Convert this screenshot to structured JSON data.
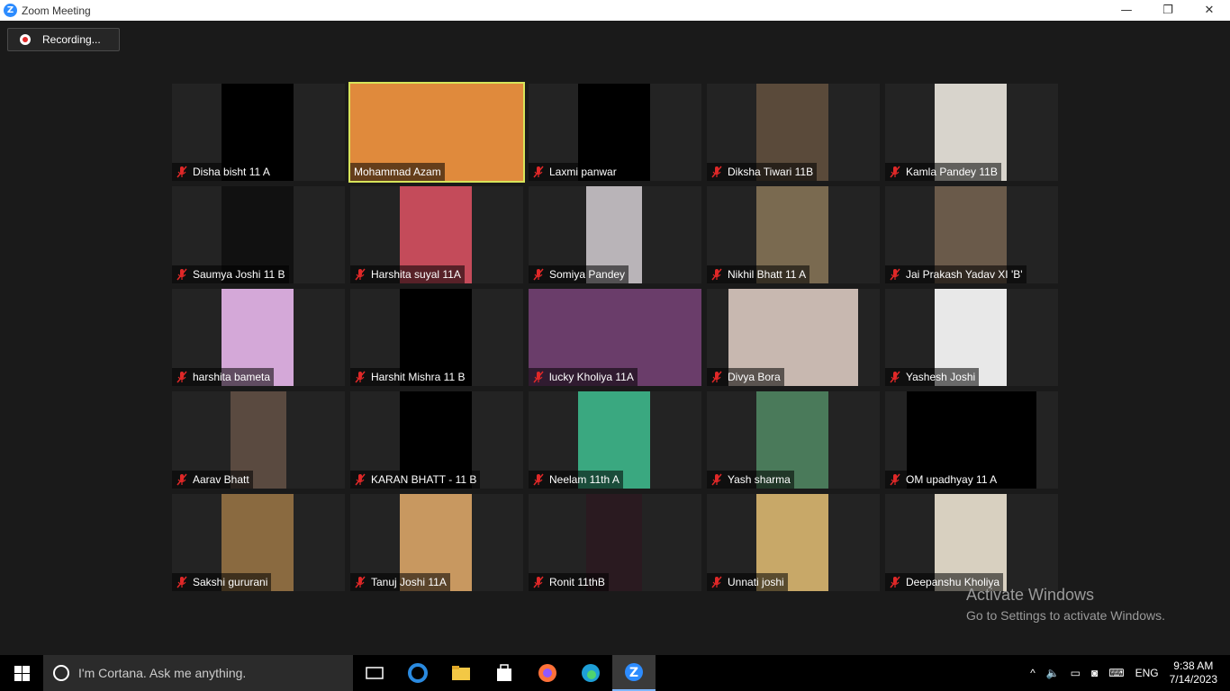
{
  "window": {
    "title": "Zoom Meeting",
    "logo_letter": "Z",
    "controls": [
      "—",
      "❐",
      "✕"
    ]
  },
  "recording": {
    "label": "Recording..."
  },
  "participants": [
    {
      "name": "Disha bisht 11 A"
    },
    {
      "name": "Mohammad Azam",
      "active_speaker": true
    },
    {
      "name": "Laxmi panwar"
    },
    {
      "name": "Diksha Tiwari 11B"
    },
    {
      "name": "Kamla Pandey 11B"
    },
    {
      "name": "Saumya Joshi 11 B"
    },
    {
      "name": "Harshita suyal 11A"
    },
    {
      "name": "Somiya Pandey"
    },
    {
      "name": "Nikhil Bhatt 11 A"
    },
    {
      "name": "Jai Prakash Yadav XI 'B'"
    },
    {
      "name": "harshita bameta"
    },
    {
      "name": "Harshit Mishra 11 B"
    },
    {
      "name": "lucky Kholiya 11A"
    },
    {
      "name": "Divya Bora"
    },
    {
      "name": "Yashesh Joshi"
    },
    {
      "name": "Aarav Bhatt"
    },
    {
      "name": "KARAN BHATT - 11 B"
    },
    {
      "name": "Neelam  11th A"
    },
    {
      "name": "Yash sharma"
    },
    {
      "name": "OM upadhyay 11 A"
    },
    {
      "name": "Sakshi gururani"
    },
    {
      "name": "Tanuj Joshi 11A"
    },
    {
      "name": "Ronit 11thB"
    },
    {
      "name": "Unnati joshi"
    },
    {
      "name": "Deepanshu Kholiya"
    }
  ],
  "watermark": {
    "line1": "Activate Windows",
    "line2": "Go to Settings to activate Windows."
  },
  "taskbar": {
    "search_placeholder": "I'm Cortana. Ask me anything.",
    "language": "ENG",
    "time": "9:38 AM",
    "date": "7/14/2023"
  },
  "colors": {
    "active_speaker_border": "#d7e45a",
    "mute_icon": "#e02828",
    "zoom_blue": "#2d8cff"
  }
}
